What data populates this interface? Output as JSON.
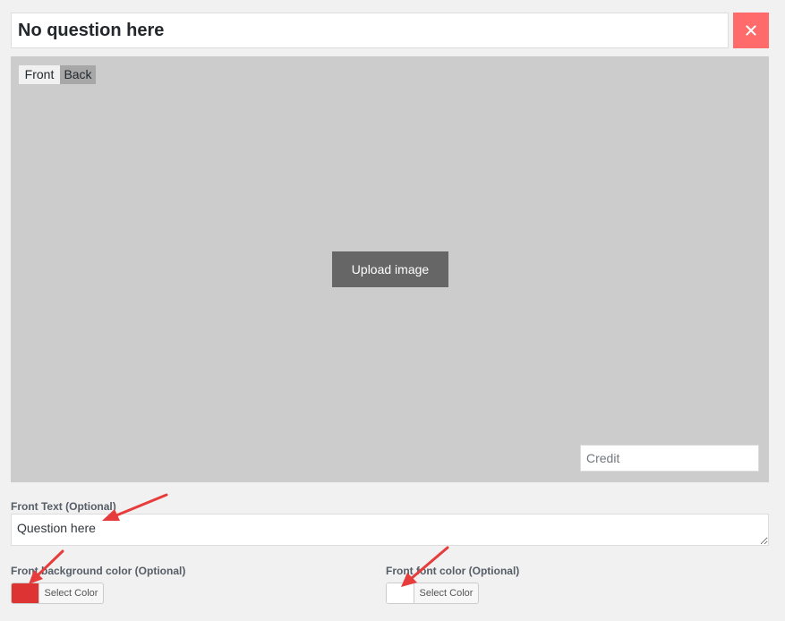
{
  "question": {
    "title_value": "No question here",
    "close_icon": "close-icon"
  },
  "card": {
    "tabs": [
      {
        "label": "Front"
      },
      {
        "label": "Back"
      }
    ],
    "upload_label": "Upload image",
    "credit_placeholder": "Credit"
  },
  "front_text": {
    "label": "Front Text (Optional)",
    "value": "Question here"
  },
  "front_background_color": {
    "label": "Front background color (Optional)",
    "swatch_color": "#dd3333",
    "button_label": "Select Color"
  },
  "front_font_color": {
    "label": "Front font color (Optional)",
    "swatch_color": "#ffffff",
    "button_label": "Select Color"
  },
  "colors": {
    "page_background": "#f1f1f1",
    "close_button": "#ff6b6b",
    "card_background": "#cccccc",
    "upload_button": "#666666",
    "annotation_arrow": "#e63c3c"
  }
}
